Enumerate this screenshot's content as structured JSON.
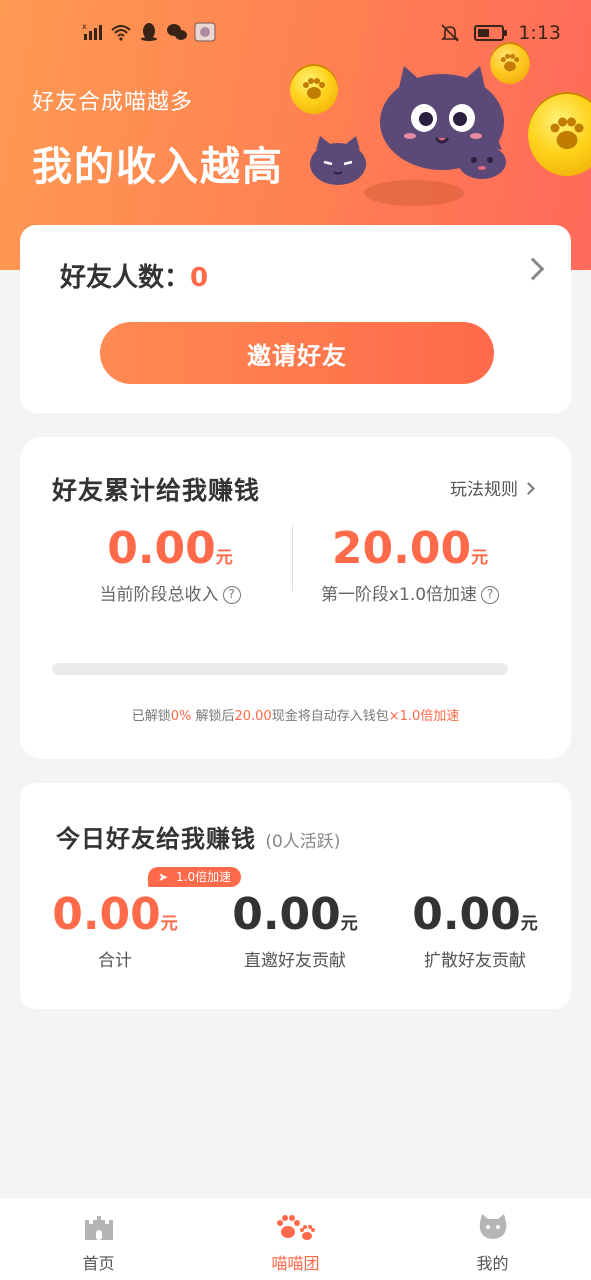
{
  "status_bar": {
    "time": "1:13",
    "icons": [
      "signal-icon",
      "wifi-icon",
      "qq-icon",
      "wechat-icon",
      "app-thumbnail-icon",
      "mute-bell-icon",
      "battery-icon"
    ]
  },
  "header": {
    "subtitle": "好友合成喵越多",
    "title": "我的收入越高"
  },
  "friends_card": {
    "label": "好友人数：",
    "count": "0",
    "invite_button": "邀请好友"
  },
  "cumulative_card": {
    "title": "好友累计给我赚钱",
    "rules_link": "玩法规则",
    "current_income": {
      "value": "0.00",
      "unit": "元",
      "label": "当前阶段总收入"
    },
    "stage_target": {
      "value": "20.00",
      "unit": "元",
      "label": "第一阶段x1.0倍加速"
    },
    "progress_fraction": 0,
    "note": {
      "p1": "已解锁",
      "unlocked": "0%",
      "p2": " 解锁后",
      "amount": "20.00",
      "p3": "现金将自动存入钱包",
      "boost": "×1.0倍加速"
    }
  },
  "today_card": {
    "title": "今日好友给我赚钱",
    "subtitle": "(0人活跃)",
    "boost_badge": "1.0倍加速",
    "stats": [
      {
        "value": "0.00",
        "unit": "元",
        "label": "合计"
      },
      {
        "value": "0.00",
        "unit": "元",
        "label": "直邀好友贡献"
      },
      {
        "value": "0.00",
        "unit": "元",
        "label": "扩散好友贡献"
      }
    ]
  },
  "tabbar": {
    "tabs": [
      {
        "label": "首页",
        "icon": "castle-icon"
      },
      {
        "label": "喵喵团",
        "icon": "paw-icon"
      },
      {
        "label": "我的",
        "icon": "cat-face-icon"
      }
    ],
    "active_index": 1
  },
  "colors": {
    "accent": "#ff6a4a",
    "header_gradient_start": "#ff9a52",
    "header_gradient_end": "#ff6a5a",
    "page_background": "#f4f4f4"
  }
}
